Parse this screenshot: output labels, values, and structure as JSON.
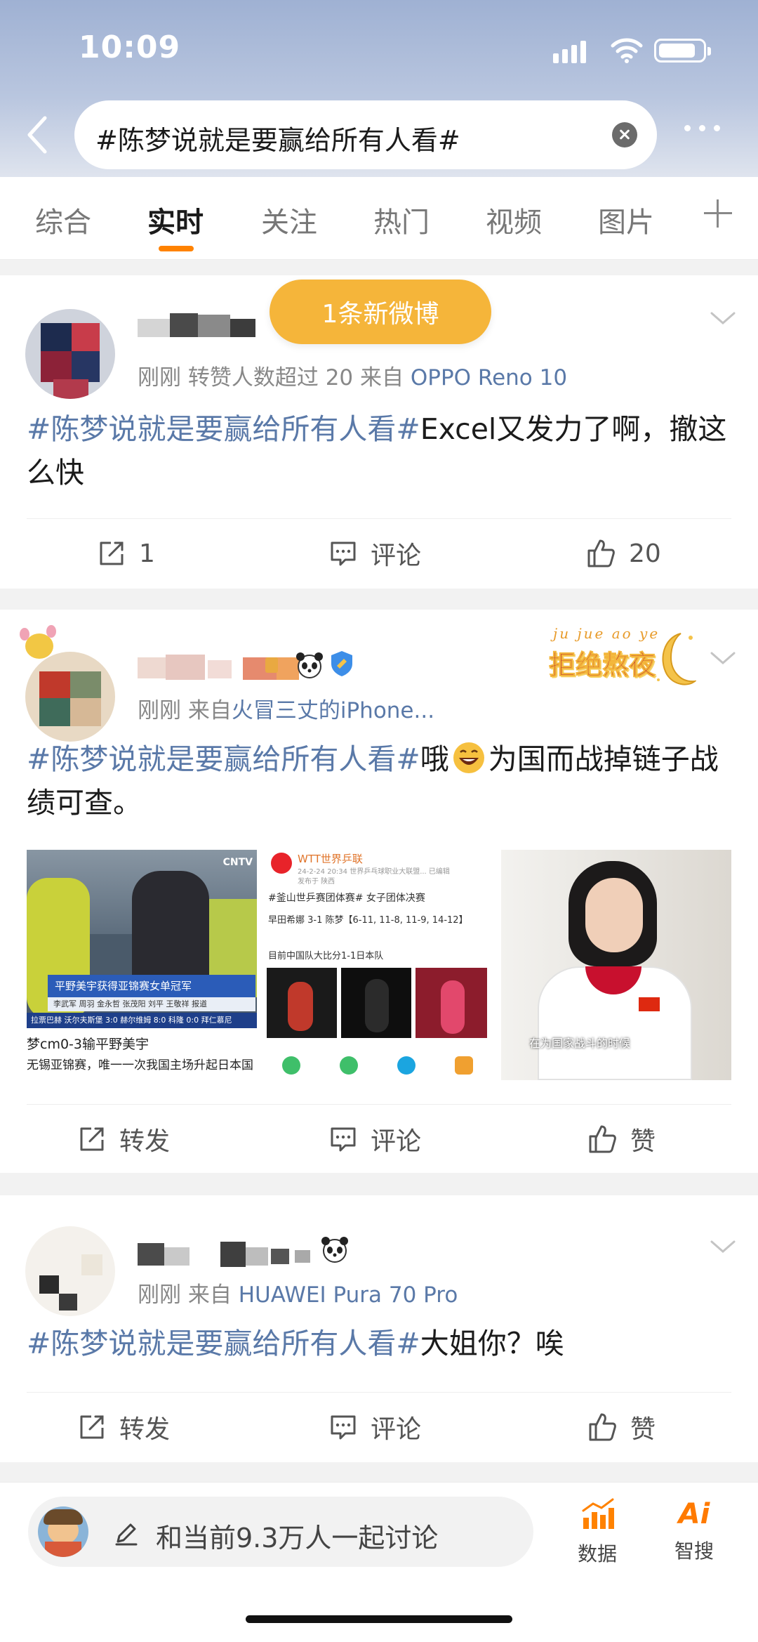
{
  "status_bar": {
    "time": "10:09",
    "battery_level": 0.85
  },
  "search": {
    "query": "#陈梦说就是要赢给所有人看#"
  },
  "tabs": [
    {
      "label": "综合",
      "active": false
    },
    {
      "label": "实时",
      "active": true
    },
    {
      "label": "关注",
      "active": false
    },
    {
      "label": "热门",
      "active": false
    },
    {
      "label": "视频",
      "active": false
    },
    {
      "label": "图片",
      "active": false
    }
  ],
  "new_posts_badge": "1条新微博",
  "accent_color": "#ff8200",
  "link_color": "#5a79a8",
  "posts": [
    {
      "meta_time": "刚刚",
      "meta_extra": "转赞人数超过 20",
      "meta_from": "来自",
      "meta_source": "OPPO Reno 10",
      "hashtag": "#陈梦说就是要赢给所有人看#",
      "text": "Excel又发力了啊，撤这么快",
      "repost_label": "1",
      "comment_label": "评论",
      "like_label": "20"
    },
    {
      "meta_time": "刚刚",
      "meta_from": "来自",
      "meta_source": "火冒三丈的iPhone...",
      "hashtag": "#陈梦说就是要赢给所有人看#",
      "text_before_emoji": "哦",
      "text_after_emoji": "为国而战掉链子战绩可查。",
      "emoji_icon": "laughing-face-icon",
      "sticker": {
        "top_text": "ju jue ao ye",
        "main_text": "拒绝熬夜"
      },
      "images": [
        {
          "caption_banner": "平野美宇获得亚锦赛女单冠军",
          "subtitle_line": "李武军 周羽 金永哲 张茂阳 刘平 王敬祥 报道",
          "ticker": "拉票巴赫 沃尔夫斯堡 3:0 赫尔维姆 8:0 科隆 0:0 拜仁慕尼",
          "bottom_line1": "梦cm0-3输平野美宇",
          "bottom_line2": "无锡亚锦赛，唯一一次我国主场升起日本国",
          "logo": "CNTV"
        },
        {
          "account": "WTT世界乒联",
          "date_line": "24-2-24 20:34  世界乒乓球职业大联盟...  已编辑",
          "place": "发布于 陕西",
          "topic": "#釜山世乒赛团体赛# 女子团体决赛",
          "score_line": "早田希娜 3-1 陈梦【6-11, 11-8, 11-9, 14-12】",
          "summary": "目前中国队大比分1-1日本队"
        },
        {
          "subtitle": "在为国家战斗的时候"
        }
      ],
      "repost_label": "转发",
      "comment_label": "评论",
      "like_label": "赞"
    },
    {
      "meta_time": "刚刚",
      "meta_from": "来自",
      "meta_source": "HUAWEI Pura 70 Pro",
      "hashtag": "#陈梦说就是要赢给所有人看#",
      "text": "大姐你？唉",
      "repost_label": "转发",
      "comment_label": "评论",
      "like_label": "赞"
    }
  ],
  "bottom_bar": {
    "compose_placeholder": "和当前9.3万人一起讨论",
    "data_label": "数据",
    "ai_badge": "Ai",
    "ai_label": "智搜"
  }
}
